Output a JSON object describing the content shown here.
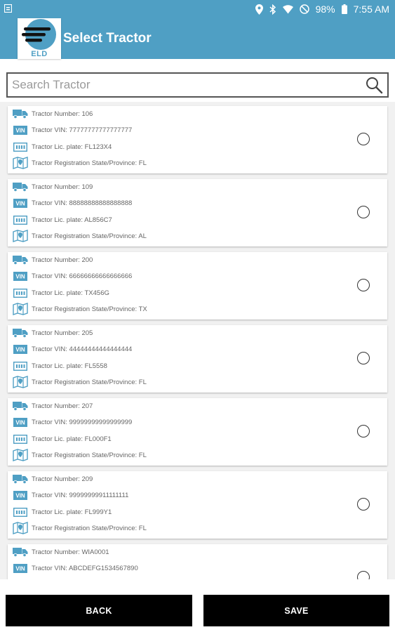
{
  "status_bar": {
    "left_icon": "notification-icon",
    "battery": "98%",
    "time": "7:55 AM"
  },
  "app_bar": {
    "logo_text": "ELD",
    "title": "Select Tractor"
  },
  "search": {
    "placeholder": "Search Tractor",
    "value": ""
  },
  "labels": {
    "number": "Tractor Number: ",
    "vin": "Tractor VIN: ",
    "plate": "Tractor Lic. plate: ",
    "state": "Tractor Registration State/Province: "
  },
  "tractors": [
    {
      "number": "106",
      "vin": "77777777777777777",
      "plate": "FL123X4",
      "state": "FL",
      "selected": false
    },
    {
      "number": "109",
      "vin": "88888888888888888",
      "plate": "AL856C7",
      "state": "AL",
      "selected": false
    },
    {
      "number": "200",
      "vin": "66666666666666666",
      "plate": "TX456G",
      "state": "TX",
      "selected": false
    },
    {
      "number": "205",
      "vin": "44444444444444444",
      "plate": "FL5558",
      "state": "FL",
      "selected": false
    },
    {
      "number": "207",
      "vin": "99999999999999999",
      "plate": "FL000F1",
      "state": "FL",
      "selected": false
    },
    {
      "number": "209",
      "vin": "99999999911111111",
      "plate": "FL999Y1",
      "state": "FL",
      "selected": false
    },
    {
      "number": "WIA0001",
      "vin": "ABCDEFG1534567890",
      "plate": "",
      "state": "",
      "selected": false
    }
  ],
  "buttons": {
    "back": "BACK",
    "save": "SAVE"
  },
  "colors": {
    "primary": "#4f9fc4",
    "button_bg": "#000000"
  }
}
